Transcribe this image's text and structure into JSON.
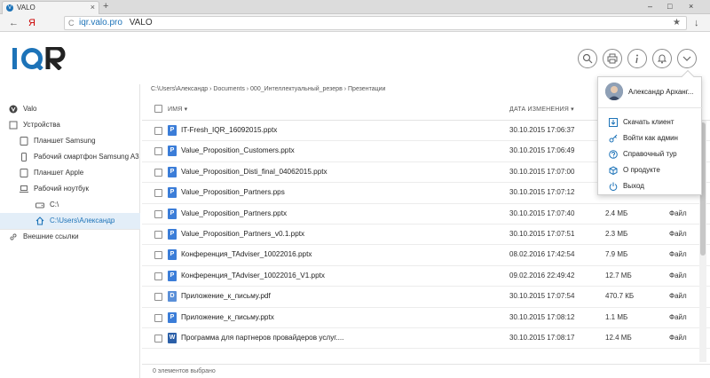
{
  "browser": {
    "tab_title": "VALO",
    "new_tab_symbol": "+",
    "close_symbol": "×",
    "window_controls": [
      "–",
      "□",
      "×"
    ],
    "address_url": "iqr.valo.pro",
    "address_title": "VALO",
    "back_symbol": "←",
    "yandex_symbol": "Я",
    "reload_symbol": "C",
    "star_symbol": "★",
    "download_symbol": "↓"
  },
  "brand": {
    "logo_text": "IQR",
    "accent": "#1d73b8"
  },
  "header_icons": [
    "search-icon",
    "printer-icon",
    "info-icon",
    "bell-icon",
    "chevron-down-icon"
  ],
  "sidebar": {
    "items": [
      {
        "label": "Valo",
        "icon": "valo-icon"
      },
      {
        "label": "Устройства",
        "icon": "devices-icon"
      },
      {
        "label": "Планшет Samsung",
        "icon": "tablet-icon"
      },
      {
        "label": "Рабочий смартфон Samsung A3",
        "icon": "phone-icon"
      },
      {
        "label": "Планшет Apple",
        "icon": "tablet-icon"
      },
      {
        "label": "Рабочий ноутбук",
        "icon": "laptop-icon"
      },
      {
        "label": "C:\\",
        "icon": "drive-icon"
      },
      {
        "label": "C:\\Users\\Александр",
        "icon": "home-icon"
      },
      {
        "label": "Внешние ссылки",
        "icon": "link-icon"
      }
    ]
  },
  "breadcrumb": "C:\\Users\\Александр  ›  Documents  ›  000_Интеллектуальный_резерв  ›  Презентации",
  "table": {
    "col_name": "Имя ▾",
    "col_date": "Дата изменения ▾",
    "rows": [
      {
        "name": "IT-Fresh_IQR_16092015.pptx",
        "date": "30.10.2015 17:06:37",
        "size": "",
        "type": "",
        "icon": "P"
      },
      {
        "name": "Value_Proposition_Customers.pptx",
        "date": "30.10.2015 17:06:49",
        "size": "",
        "type": "",
        "icon": "P"
      },
      {
        "name": "Value_Proposition_Disti_final_04062015.pptx",
        "date": "30.10.2015 17:07:00",
        "size": "",
        "type": "",
        "icon": "P"
      },
      {
        "name": "Value_Proposition_Partners.pps",
        "date": "30.10.2015 17:07:12",
        "size": "",
        "type": "",
        "icon": "P"
      },
      {
        "name": "Value_Proposition_Partners.pptx",
        "date": "30.10.2015 17:07:40",
        "size": "2.4 МБ",
        "type": "Файл",
        "icon": "P"
      },
      {
        "name": "Value_Proposition_Partners_v0.1.pptx",
        "date": "30.10.2015 17:07:51",
        "size": "2.3 МБ",
        "type": "Файл",
        "icon": "P"
      },
      {
        "name": "Конференция_TAdviser_10022016.pptx",
        "date": "08.02.2016 17:42:54",
        "size": "7.9 МБ",
        "type": "Файл",
        "icon": "P"
      },
      {
        "name": "Конференция_TAdviser_10022016_V1.pptx",
        "date": "09.02.2016 22:49:42",
        "size": "12.7 МБ",
        "type": "Файл",
        "icon": "P"
      },
      {
        "name": "Приложение_к_письму.pdf",
        "date": "30.10.2015 17:07:54",
        "size": "470.7 КБ",
        "type": "Файл",
        "icon": "D"
      },
      {
        "name": "Приложение_к_письму.pptx",
        "date": "30.10.2015 17:08:12",
        "size": "1.1 МБ",
        "type": "Файл",
        "icon": "P"
      },
      {
        "name": "Программа для партнеров провайдеров услуг....",
        "date": "30.10.2015 17:08:17",
        "size": "12.4 МБ",
        "type": "Файл",
        "icon": "W"
      }
    ]
  },
  "status": "0 элементов выбрано",
  "user_menu": {
    "user_name": "Александр Арханг...",
    "items": [
      {
        "label": "Скачать клиент",
        "icon": "download-icon"
      },
      {
        "label": "Войти как админ",
        "icon": "key-icon"
      },
      {
        "label": "Справочный тур",
        "icon": "help-icon"
      },
      {
        "label": "О продукте",
        "icon": "box-icon"
      },
      {
        "label": "Выход",
        "icon": "power-icon"
      }
    ]
  }
}
